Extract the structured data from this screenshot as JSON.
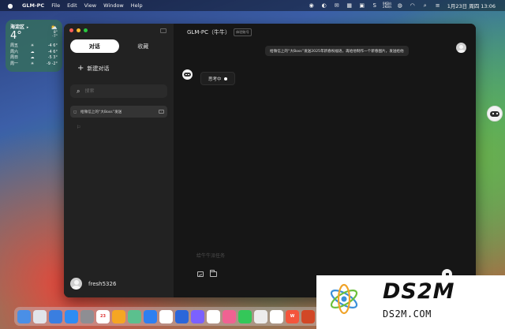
{
  "menubar": {
    "app_name": "GLM-PC",
    "menus": [
      "File",
      "Edit",
      "View",
      "Window",
      "Help"
    ],
    "clock": "1月23日 周四 13:06",
    "stats_label": "9KB/s\n2KB/s"
  },
  "weather": {
    "location": "海淀区",
    "location_arrow": "➤",
    "temperature": "4°",
    "condition_icon": "cloud-sun-icon",
    "high": "8°",
    "low": "-7°",
    "forecast": [
      {
        "day": "周五",
        "icon": "☀",
        "range": "-4  6°"
      },
      {
        "day": "周六",
        "icon": "☁",
        "range": "-4  6°"
      },
      {
        "day": "周日",
        "icon": "☁",
        "range": "-5  3°"
      },
      {
        "day": "周一",
        "icon": "☀",
        "range": "-9  -2°"
      }
    ]
  },
  "sidebar": {
    "tabs": [
      {
        "label": "对话",
        "active": true
      },
      {
        "label": "收藏",
        "active": false
      }
    ],
    "new_chat_label": "新建对话",
    "search_placeholder": "搜索",
    "history": [
      {
        "title": "给微信上的“大Boss”发送"
      }
    ],
    "user_name": "fresh5326"
  },
  "main": {
    "title": "GLM-PC（牛牛）",
    "badge": "体验账号",
    "user_message": "给微信上的“大Boss”发送2025年新春祝福语，再给他制作一个新春图片，发送给他",
    "thinking_label": "思考中",
    "composer_placeholder": "给牛牛派任务"
  },
  "dock": {
    "apps": [
      {
        "name": "finder",
        "color": "#4a8fe6"
      },
      {
        "name": "launchpad",
        "color": "#e1e4ea"
      },
      {
        "name": "finder-2",
        "color": "#3a7ee0"
      },
      {
        "name": "app-store",
        "color": "#2f8cf2"
      },
      {
        "name": "system-settings",
        "color": "#8e8e93"
      },
      {
        "name": "calendar",
        "color": "#ffffff",
        "label": "23"
      },
      {
        "name": "photos",
        "color": "#f5a623"
      },
      {
        "name": "maps",
        "color": "#5bc08e"
      },
      {
        "name": "safari",
        "color": "#2e7ff0"
      },
      {
        "name": "chrome",
        "color": "#ffffff"
      },
      {
        "name": "app-blue",
        "color": "#2b66d9"
      },
      {
        "name": "app-mixed",
        "color": "#7b61ff"
      },
      {
        "name": "chatgpt",
        "color": "#ffffff"
      },
      {
        "name": "app-pink",
        "color": "#f06292"
      },
      {
        "name": "app-green",
        "color": "#34c759"
      },
      {
        "name": "app-circle",
        "color": "#ececec"
      },
      {
        "name": "app-white",
        "color": "#ffffff"
      },
      {
        "name": "wps",
        "color": "#f4553c",
        "label": "W"
      },
      {
        "name": "ppt",
        "color": "#d24726"
      },
      {
        "name": "app-last",
        "color": "#444444"
      }
    ]
  },
  "watermark": {
    "title": "DS2M",
    "subtitle": "DS2M.COM"
  }
}
